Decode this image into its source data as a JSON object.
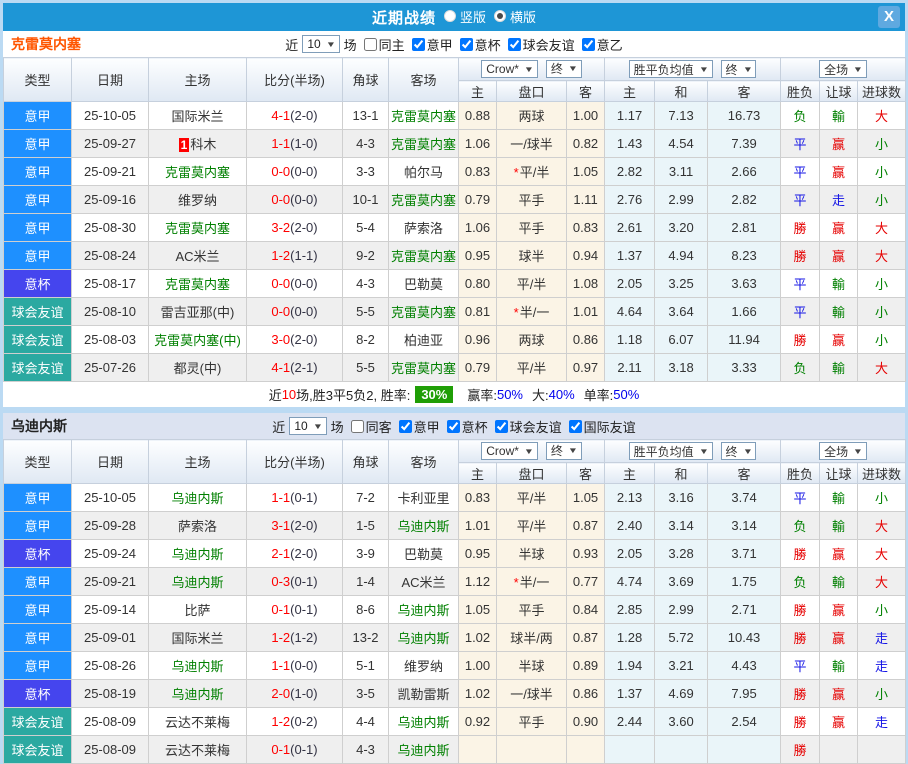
{
  "titlebar": {
    "title": "近期战绩",
    "radios": [
      {
        "label": "竖版",
        "on": false
      },
      {
        "label": "横版",
        "on": true
      }
    ],
    "close_label": "X"
  },
  "columns": {
    "main": [
      "类型",
      "日期",
      "主场",
      "比分(半场)",
      "角球",
      "客场"
    ],
    "dropdowns": [
      "Crow*",
      "终",
      "胜平负均值",
      "终",
      "全场"
    ],
    "sub": [
      "主",
      "盘口",
      "客",
      "主",
      "和",
      "客",
      "胜负",
      "让球",
      "进球数"
    ]
  },
  "palette": {
    "titlebar": "#1E96D6",
    "close_btn": "#5FA9E0",
    "frame": "#BBDAF3",
    "league": {
      "意甲": "#1E90FF",
      "意杯": "#4545EE",
      "球会友谊": "#2BA9A1"
    },
    "mark": {
      "r": "#E60000",
      "b": "#1414E6",
      "g": "#008000"
    },
    "team_highlight": "#008000",
    "score": "#FF0000",
    "half": "#333344",
    "odds_bg": "#FBF4E6",
    "avg_bg": "#EAF5F9",
    "alt_row": "#EFEFEF",
    "team1": "#FF5500",
    "team2": "#222222",
    "band2_bg": "#DCE3F1",
    "rate_badge": "#1F9E06",
    "value_blue": "#0000EE"
  },
  "sections": [
    {
      "team": "克雷莫内塞",
      "filter": {
        "near": "近",
        "count": "10",
        "unit": "场",
        "checks": [
          {
            "label": "同主",
            "on": false
          },
          {
            "label": "意甲",
            "on": true
          },
          {
            "label": "意杯",
            "on": true
          },
          {
            "label": "球会友谊",
            "on": true
          },
          {
            "label": "意乙",
            "on": true
          }
        ]
      },
      "rows": [
        {
          "league": "意甲",
          "date": "25-10-05",
          "home": "国际米兰",
          "home_hl": false,
          "badge": "",
          "score": "4-1",
          "half": "(2-0)",
          "corner": "13-1",
          "away": "克雷莫内塞",
          "away_hl": true,
          "o1": "0.88",
          "line": "两球",
          "star": false,
          "o2": "1.00",
          "a1": "1.17",
          "a2": "7.13",
          "a3": "16.73",
          "res": "负",
          "res_c": "g",
          "han": "輸",
          "han_c": "g",
          "goal": "大",
          "goal_c": "r"
        },
        {
          "league": "意甲",
          "date": "25-09-27",
          "home": "科木",
          "home_hl": false,
          "badge": "1",
          "score": "1-1",
          "half": "(1-0)",
          "corner": "4-3",
          "away": "克雷莫内塞",
          "away_hl": true,
          "o1": "1.06",
          "line": "一/球半",
          "star": false,
          "o2": "0.82",
          "a1": "1.43",
          "a2": "4.54",
          "a3": "7.39",
          "res": "平",
          "res_c": "b",
          "han": "赢",
          "han_c": "r",
          "goal": "小",
          "goal_c": "g"
        },
        {
          "league": "意甲",
          "date": "25-09-21",
          "home": "克雷莫内塞",
          "home_hl": true,
          "badge": "",
          "score": "0-0",
          "half": "(0-0)",
          "corner": "3-3",
          "away": "帕尔马",
          "away_hl": false,
          "o1": "0.83",
          "line": "平/半",
          "star": true,
          "o2": "1.05",
          "a1": "2.82",
          "a2": "3.11",
          "a3": "2.66",
          "res": "平",
          "res_c": "b",
          "han": "赢",
          "han_c": "r",
          "goal": "小",
          "goal_c": "g"
        },
        {
          "league": "意甲",
          "date": "25-09-16",
          "home": "维罗纳",
          "home_hl": false,
          "badge": "",
          "score": "0-0",
          "half": "(0-0)",
          "corner": "10-1",
          "away": "克雷莫内塞",
          "away_hl": true,
          "o1": "0.79",
          "line": "平手",
          "star": false,
          "o2": "1.11",
          "a1": "2.76",
          "a2": "2.99",
          "a3": "2.82",
          "res": "平",
          "res_c": "b",
          "han": "走",
          "han_c": "b",
          "goal": "小",
          "goal_c": "g"
        },
        {
          "league": "意甲",
          "date": "25-08-30",
          "home": "克雷莫内塞",
          "home_hl": true,
          "badge": "",
          "score": "3-2",
          "half": "(2-0)",
          "corner": "5-4",
          "away": "萨索洛",
          "away_hl": false,
          "o1": "1.06",
          "line": "平手",
          "star": false,
          "o2": "0.83",
          "a1": "2.61",
          "a2": "3.20",
          "a3": "2.81",
          "res": "勝",
          "res_c": "r",
          "han": "赢",
          "han_c": "r",
          "goal": "大",
          "goal_c": "r"
        },
        {
          "league": "意甲",
          "date": "25-08-24",
          "home": "AC米兰",
          "home_hl": false,
          "badge": "",
          "score": "1-2",
          "half": "(1-1)",
          "corner": "9-2",
          "away": "克雷莫内塞",
          "away_hl": true,
          "o1": "0.95",
          "line": "球半",
          "star": false,
          "o2": "0.94",
          "a1": "1.37",
          "a2": "4.94",
          "a3": "8.23",
          "res": "勝",
          "res_c": "r",
          "han": "赢",
          "han_c": "r",
          "goal": "大",
          "goal_c": "r"
        },
        {
          "league": "意杯",
          "date": "25-08-17",
          "home": "克雷莫内塞",
          "home_hl": true,
          "badge": "",
          "score": "0-0",
          "half": "(0-0)",
          "corner": "4-3",
          "away": "巴勒莫",
          "away_hl": false,
          "o1": "0.80",
          "line": "平/半",
          "star": false,
          "o2": "1.08",
          "a1": "2.05",
          "a2": "3.25",
          "a3": "3.63",
          "res": "平",
          "res_c": "b",
          "han": "輸",
          "han_c": "g",
          "goal": "小",
          "goal_c": "g"
        },
        {
          "league": "球会友谊",
          "date": "25-08-10",
          "home": "雷吉亚那(中)",
          "home_hl": false,
          "badge": "",
          "score": "0-0",
          "half": "(0-0)",
          "corner": "5-5",
          "away": "克雷莫内塞",
          "away_hl": true,
          "o1": "0.81",
          "line": "半/一",
          "star": true,
          "o2": "1.01",
          "a1": "4.64",
          "a2": "3.64",
          "a3": "1.66",
          "res": "平",
          "res_c": "b",
          "han": "輸",
          "han_c": "g",
          "goal": "小",
          "goal_c": "g"
        },
        {
          "league": "球会友谊",
          "date": "25-08-03",
          "home": "克雷莫内塞(中)",
          "home_hl": true,
          "badge": "",
          "score": "3-0",
          "half": "(2-0)",
          "corner": "8-2",
          "away": "柏迪亚",
          "away_hl": false,
          "o1": "0.96",
          "line": "两球",
          "star": false,
          "o2": "0.86",
          "a1": "1.18",
          "a2": "6.07",
          "a3": "11.94",
          "res": "勝",
          "res_c": "r",
          "han": "赢",
          "han_c": "r",
          "goal": "小",
          "goal_c": "g"
        },
        {
          "league": "球会友谊",
          "date": "25-07-26",
          "home": "都灵(中)",
          "home_hl": false,
          "badge": "",
          "score": "4-1",
          "half": "(2-1)",
          "corner": "5-5",
          "away": "克雷莫内塞",
          "away_hl": true,
          "o1": "0.79",
          "line": "平/半",
          "star": false,
          "o2": "0.97",
          "a1": "2.11",
          "a2": "3.18",
          "a3": "3.33",
          "res": "负",
          "res_c": "g",
          "han": "輸",
          "han_c": "g",
          "goal": "大",
          "goal_c": "r"
        }
      ],
      "summary": {
        "pre": "近",
        "count": "10",
        "mid": "场,胜3平5负2, 胜率:",
        "rate": "30%",
        "stats": [
          {
            "label": "赢率:",
            "value": "50%"
          },
          {
            "label": "大:",
            "value": "40%"
          },
          {
            "label": "单率:",
            "value": "50%"
          }
        ]
      }
    },
    {
      "team": "乌迪内斯",
      "filter": {
        "near": "近",
        "count": "10",
        "unit": "场",
        "checks": [
          {
            "label": "同客",
            "on": false
          },
          {
            "label": "意甲",
            "on": true
          },
          {
            "label": "意杯",
            "on": true
          },
          {
            "label": "球会友谊",
            "on": true
          },
          {
            "label": "国际友谊",
            "on": true
          }
        ]
      },
      "rows": [
        {
          "league": "意甲",
          "date": "25-10-05",
          "home": "乌迪内斯",
          "home_hl": true,
          "badge": "",
          "score": "1-1",
          "half": "(0-1)",
          "corner": "7-2",
          "away": "卡利亚里",
          "away_hl": false,
          "o1": "0.83",
          "line": "平/半",
          "star": false,
          "o2": "1.05",
          "a1": "2.13",
          "a2": "3.16",
          "a3": "3.74",
          "res": "平",
          "res_c": "b",
          "han": "輸",
          "han_c": "g",
          "goal": "小",
          "goal_c": "g"
        },
        {
          "league": "意甲",
          "date": "25-09-28",
          "home": "萨索洛",
          "home_hl": false,
          "badge": "",
          "score": "3-1",
          "half": "(2-0)",
          "corner": "1-5",
          "away": "乌迪内斯",
          "away_hl": true,
          "o1": "1.01",
          "line": "平/半",
          "star": false,
          "o2": "0.87",
          "a1": "2.40",
          "a2": "3.14",
          "a3": "3.14",
          "res": "负",
          "res_c": "g",
          "han": "輸",
          "han_c": "g",
          "goal": "大",
          "goal_c": "r"
        },
        {
          "league": "意杯",
          "date": "25-09-24",
          "home": "乌迪内斯",
          "home_hl": true,
          "badge": "",
          "score": "2-1",
          "half": "(2-0)",
          "corner": "3-9",
          "away": "巴勒莫",
          "away_hl": false,
          "o1": "0.95",
          "line": "半球",
          "star": false,
          "o2": "0.93",
          "a1": "2.05",
          "a2": "3.28",
          "a3": "3.71",
          "res": "勝",
          "res_c": "r",
          "han": "赢",
          "han_c": "r",
          "goal": "大",
          "goal_c": "r"
        },
        {
          "league": "意甲",
          "date": "25-09-21",
          "home": "乌迪内斯",
          "home_hl": true,
          "badge": "",
          "score": "0-3",
          "half": "(0-1)",
          "corner": "1-4",
          "away": "AC米兰",
          "away_hl": false,
          "o1": "1.12",
          "line": "半/一",
          "star": true,
          "o2": "0.77",
          "a1": "4.74",
          "a2": "3.69",
          "a3": "1.75",
          "res": "负",
          "res_c": "g",
          "han": "輸",
          "han_c": "g",
          "goal": "大",
          "goal_c": "r"
        },
        {
          "league": "意甲",
          "date": "25-09-14",
          "home": "比萨",
          "home_hl": false,
          "badge": "",
          "score": "0-1",
          "half": "(0-1)",
          "corner": "8-6",
          "away": "乌迪内斯",
          "away_hl": true,
          "o1": "1.05",
          "line": "平手",
          "star": false,
          "o2": "0.84",
          "a1": "2.85",
          "a2": "2.99",
          "a3": "2.71",
          "res": "勝",
          "res_c": "r",
          "han": "赢",
          "han_c": "r",
          "goal": "小",
          "goal_c": "g"
        },
        {
          "league": "意甲",
          "date": "25-09-01",
          "home": "国际米兰",
          "home_hl": false,
          "badge": "",
          "score": "1-2",
          "half": "(1-2)",
          "corner": "13-2",
          "away": "乌迪内斯",
          "away_hl": true,
          "o1": "1.02",
          "line": "球半/两",
          "star": false,
          "o2": "0.87",
          "a1": "1.28",
          "a2": "5.72",
          "a3": "10.43",
          "res": "勝",
          "res_c": "r",
          "han": "赢",
          "han_c": "r",
          "goal": "走",
          "goal_c": "b"
        },
        {
          "league": "意甲",
          "date": "25-08-26",
          "home": "乌迪内斯",
          "home_hl": true,
          "badge": "",
          "score": "1-1",
          "half": "(0-0)",
          "corner": "5-1",
          "away": "维罗纳",
          "away_hl": false,
          "o1": "1.00",
          "line": "半球",
          "star": false,
          "o2": "0.89",
          "a1": "1.94",
          "a2": "3.21",
          "a3": "4.43",
          "res": "平",
          "res_c": "b",
          "han": "輸",
          "han_c": "g",
          "goal": "走",
          "goal_c": "b"
        },
        {
          "league": "意杯",
          "date": "25-08-19",
          "home": "乌迪内斯",
          "home_hl": true,
          "badge": "",
          "score": "2-0",
          "half": "(1-0)",
          "corner": "3-5",
          "away": "凯勒雷斯",
          "away_hl": false,
          "o1": "1.02",
          "line": "一/球半",
          "star": false,
          "o2": "0.86",
          "a1": "1.37",
          "a2": "4.69",
          "a3": "7.95",
          "res": "勝",
          "res_c": "r",
          "han": "赢",
          "han_c": "r",
          "goal": "小",
          "goal_c": "g"
        },
        {
          "league": "球会友谊",
          "date": "25-08-09",
          "home": "云达不莱梅",
          "home_hl": false,
          "badge": "",
          "score": "1-2",
          "half": "(0-2)",
          "corner": "4-4",
          "away": "乌迪内斯",
          "away_hl": true,
          "o1": "0.92",
          "line": "平手",
          "star": false,
          "o2": "0.90",
          "a1": "2.44",
          "a2": "3.60",
          "a3": "2.54",
          "res": "勝",
          "res_c": "r",
          "han": "赢",
          "han_c": "r",
          "goal": "走",
          "goal_c": "b"
        },
        {
          "league": "球会友谊",
          "date": "25-08-09",
          "home": "云达不莱梅",
          "home_hl": false,
          "badge": "",
          "score": "0-1",
          "half": "(0-1)",
          "corner": "4-3",
          "away": "乌迪内斯",
          "away_hl": true,
          "o1": "",
          "line": "",
          "star": false,
          "o2": "",
          "a1": "",
          "a2": "",
          "a3": "",
          "res": "勝",
          "res_c": "r",
          "han": "",
          "han_c": "",
          "goal": "",
          "goal_c": ""
        }
      ]
    }
  ]
}
